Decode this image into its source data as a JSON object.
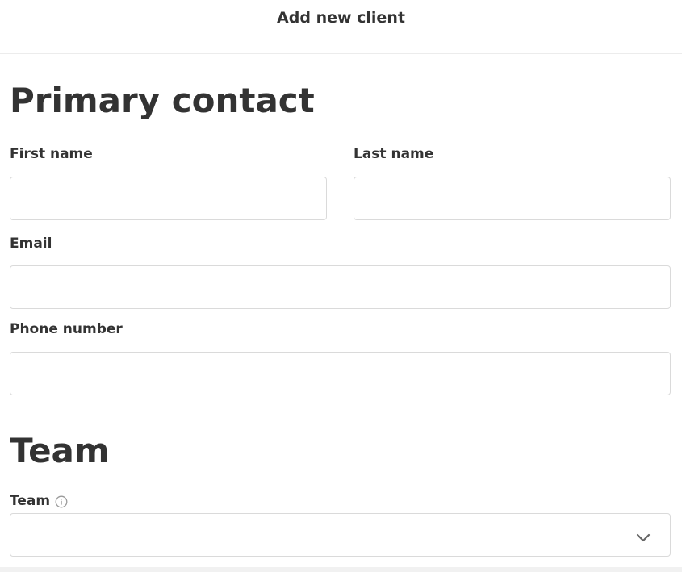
{
  "header": {
    "title": "Add new client"
  },
  "primary_contact": {
    "heading": "Primary contact",
    "first_name": {
      "label": "First name",
      "value": ""
    },
    "last_name": {
      "label": "Last name",
      "value": ""
    },
    "email": {
      "label": "Email",
      "value": ""
    },
    "phone": {
      "label": "Phone number",
      "value": ""
    }
  },
  "team_section": {
    "heading": "Team",
    "team_field": {
      "label": "Team",
      "selected": "",
      "icons": {
        "info": "info-icon",
        "dropdown": "chevron-down-icon"
      }
    }
  },
  "colors": {
    "text": "#333333",
    "border": "#dadada",
    "icon": "#9a9a9a",
    "chevron": "#666666"
  }
}
